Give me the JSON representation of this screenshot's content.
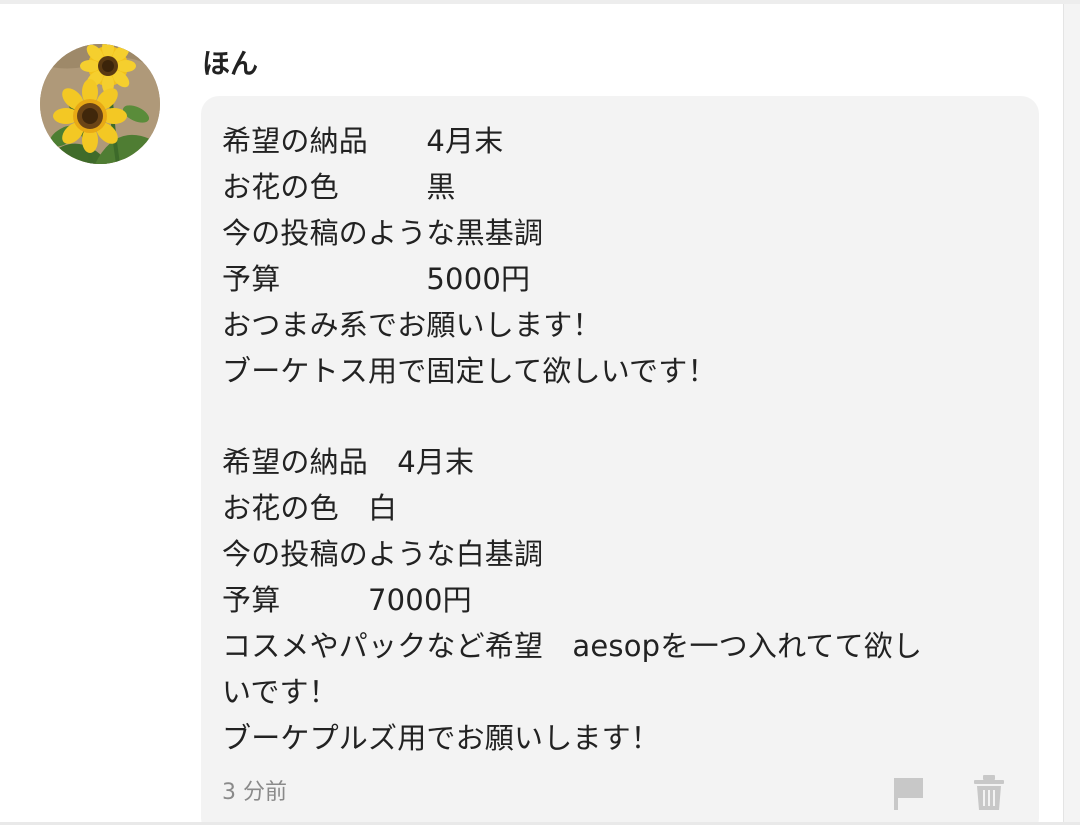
{
  "post": {
    "username": "ほん",
    "message": "希望の納品　　4月末\nお花の色　　　黒\n今の投稿のような黒基調\n予算　　　　　5000円\nおつまみ系でお願いします！\nブーケトス用で固定して欲しいです！\n\n希望の納品　4月末\nお花の色　白\n今の投稿のような白基調\n予算　　　7000円\nコスメやパックなど希望　aesopを一つ入れてて欲し\nいです！\nブーケプルズ用でお願いします！",
    "timestamp": "3 分前"
  },
  "icons": {
    "avatar": "sunflower-avatar",
    "report": "flag-icon",
    "delete": "trash-icon"
  },
  "colors": {
    "bubble_background": "#f3f3f3",
    "text": "#222222",
    "timestamp": "#8a8a8a",
    "icon": "#c8c8c8"
  }
}
